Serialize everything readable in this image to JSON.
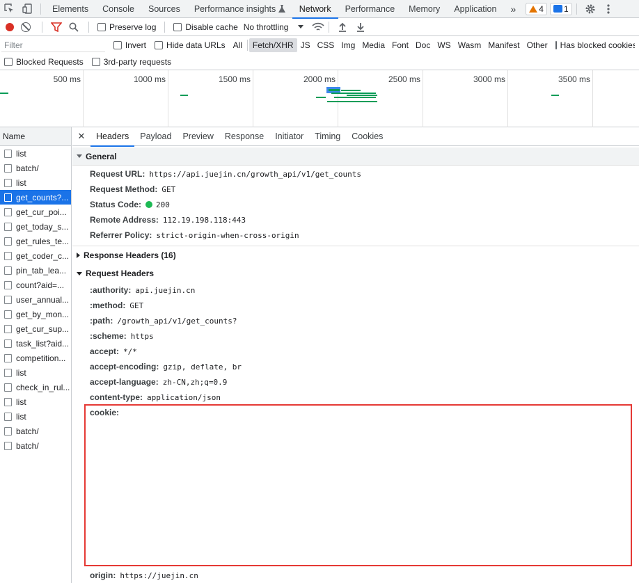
{
  "tabs": [
    {
      "label": "Elements"
    },
    {
      "label": "Console"
    },
    {
      "label": "Sources"
    },
    {
      "label": "Performance insights"
    },
    {
      "label": "Network"
    },
    {
      "label": "Performance"
    },
    {
      "label": "Memory"
    },
    {
      "label": "Application"
    }
  ],
  "badges": {
    "warnings": "4",
    "messages": "1"
  },
  "toolbar": {
    "preserve_log": "Preserve log",
    "disable_cache": "Disable cache",
    "throttling": "No throttling"
  },
  "filter": {
    "placeholder": "Filter",
    "invert": "Invert",
    "hide_data_urls": "Hide data URLs",
    "types": [
      "All",
      "Fetch/XHR",
      "JS",
      "CSS",
      "Img",
      "Media",
      "Font",
      "Doc",
      "WS",
      "Wasm",
      "Manifest",
      "Other"
    ],
    "has_blocked_cookies": "Has blocked cookies",
    "blocked_requests": "Blocked Requests",
    "third_party": "3rd-party requests"
  },
  "overview": {
    "ticks": [
      "500 ms",
      "1000 ms",
      "1500 ms",
      "2000 ms",
      "2500 ms",
      "3000 ms",
      "3500 ms"
    ]
  },
  "request_list": {
    "header": "Name",
    "items": [
      "list",
      "batch/",
      "list",
      "get_counts?...",
      "get_cur_poi...",
      "get_today_s...",
      "get_rules_te...",
      "get_coder_c...",
      "pin_tab_lea...",
      "count?aid=...",
      "user_annual...",
      "get_by_mon...",
      "get_cur_sup...",
      "task_list?aid...",
      "competition...",
      "list",
      "check_in_rul...",
      "list",
      "list",
      "batch/",
      "batch/"
    ],
    "selected_index": 3
  },
  "detail": {
    "tabs": [
      "Headers",
      "Payload",
      "Preview",
      "Response",
      "Initiator",
      "Timing",
      "Cookies"
    ],
    "general": {
      "title": "General",
      "rows": [
        {
          "k": "Request URL:",
          "v": "https://api.juejin.cn/growth_api/v1/get_counts"
        },
        {
          "k": "Request Method:",
          "v": "GET"
        },
        {
          "k": "Status Code:",
          "v": "200"
        },
        {
          "k": "Remote Address:",
          "v": "112.19.198.118:443"
        },
        {
          "k": "Referrer Policy:",
          "v": "strict-origin-when-cross-origin"
        }
      ]
    },
    "response_headers": "Response Headers (16)",
    "request_headers": {
      "title": "Request Headers",
      "rows": [
        {
          "k": ":authority:",
          "v": "api.juejin.cn"
        },
        {
          "k": ":method:",
          "v": "GET"
        },
        {
          "k": ":path:",
          "v": "/growth_api/v1/get_counts?"
        },
        {
          "k": ":scheme:",
          "v": "https"
        },
        {
          "k": "accept:",
          "v": "*/*"
        },
        {
          "k": "accept-encoding:",
          "v": "gzip, deflate, br"
        },
        {
          "k": "accept-language:",
          "v": "zh-CN,zh;q=0.9"
        },
        {
          "k": "content-type:",
          "v": "application/json"
        }
      ],
      "cookie_key": "cookie:",
      "origin_key": "origin:",
      "origin_value": "https://juejin.cn"
    }
  }
}
